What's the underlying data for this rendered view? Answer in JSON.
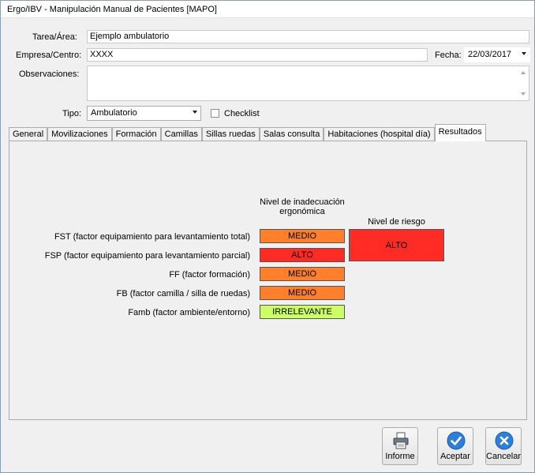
{
  "window": {
    "title": "Ergo/IBV - Manipulación Manual de Pacientes [MAPO]"
  },
  "form": {
    "tarea_label": "Tarea/Área:",
    "tarea_value": "Ejemplo ambulatorio",
    "empresa_label": "Empresa/Centro:",
    "empresa_value": "XXXX",
    "fecha_label": "Fecha:",
    "fecha_value": "22/03/2017",
    "observaciones_label": "Observaciones:",
    "observaciones_value": "",
    "tipo_label": "Tipo:",
    "tipo_value": "Ambulatorio",
    "checklist_label": "Checklist",
    "checklist_checked": false
  },
  "tabs": [
    {
      "label": "General"
    },
    {
      "label": "Movilizaciones"
    },
    {
      "label": "Formación"
    },
    {
      "label": "Camillas"
    },
    {
      "label": "Sillas ruedas"
    },
    {
      "label": "Salas consulta"
    },
    {
      "label": "Habitaciones (hospital día)"
    },
    {
      "label": "Resultados",
      "active": true
    }
  ],
  "results": {
    "col_inadecuacion": "Nivel de inadecuación ergonómica",
    "col_riesgo": "Nivel de riesgo",
    "rows": [
      {
        "label": "FST (factor equipamiento para levantamiento total)",
        "value": "MEDIO",
        "color": "#ff7f2a"
      },
      {
        "label": "FSP (factor equipamiento para levantamiento parcial)",
        "value": "ALTO",
        "color": "#ff2b24"
      },
      {
        "label": "FF (factor formación)",
        "value": "MEDIO",
        "color": "#ff7f2a"
      },
      {
        "label": "FB (factor camilla / silla de ruedas)",
        "value": "MEDIO",
        "color": "#ff7f2a"
      },
      {
        "label": "Famb (factor ambiente/entorno)",
        "value": "IRRELEVANTE",
        "color": "#ccff66"
      }
    ],
    "riesgo_value": "ALTO",
    "riesgo_color": "#ff2b24"
  },
  "buttons": {
    "informe": "Informe",
    "aceptar": "Aceptar",
    "cancelar": "Cancelar"
  },
  "icons": {
    "printer": "printer-icon",
    "accept": "checkmark-icon",
    "cancel": "close-icon"
  },
  "colors": {
    "accent_blue": "#2f7ed8"
  }
}
